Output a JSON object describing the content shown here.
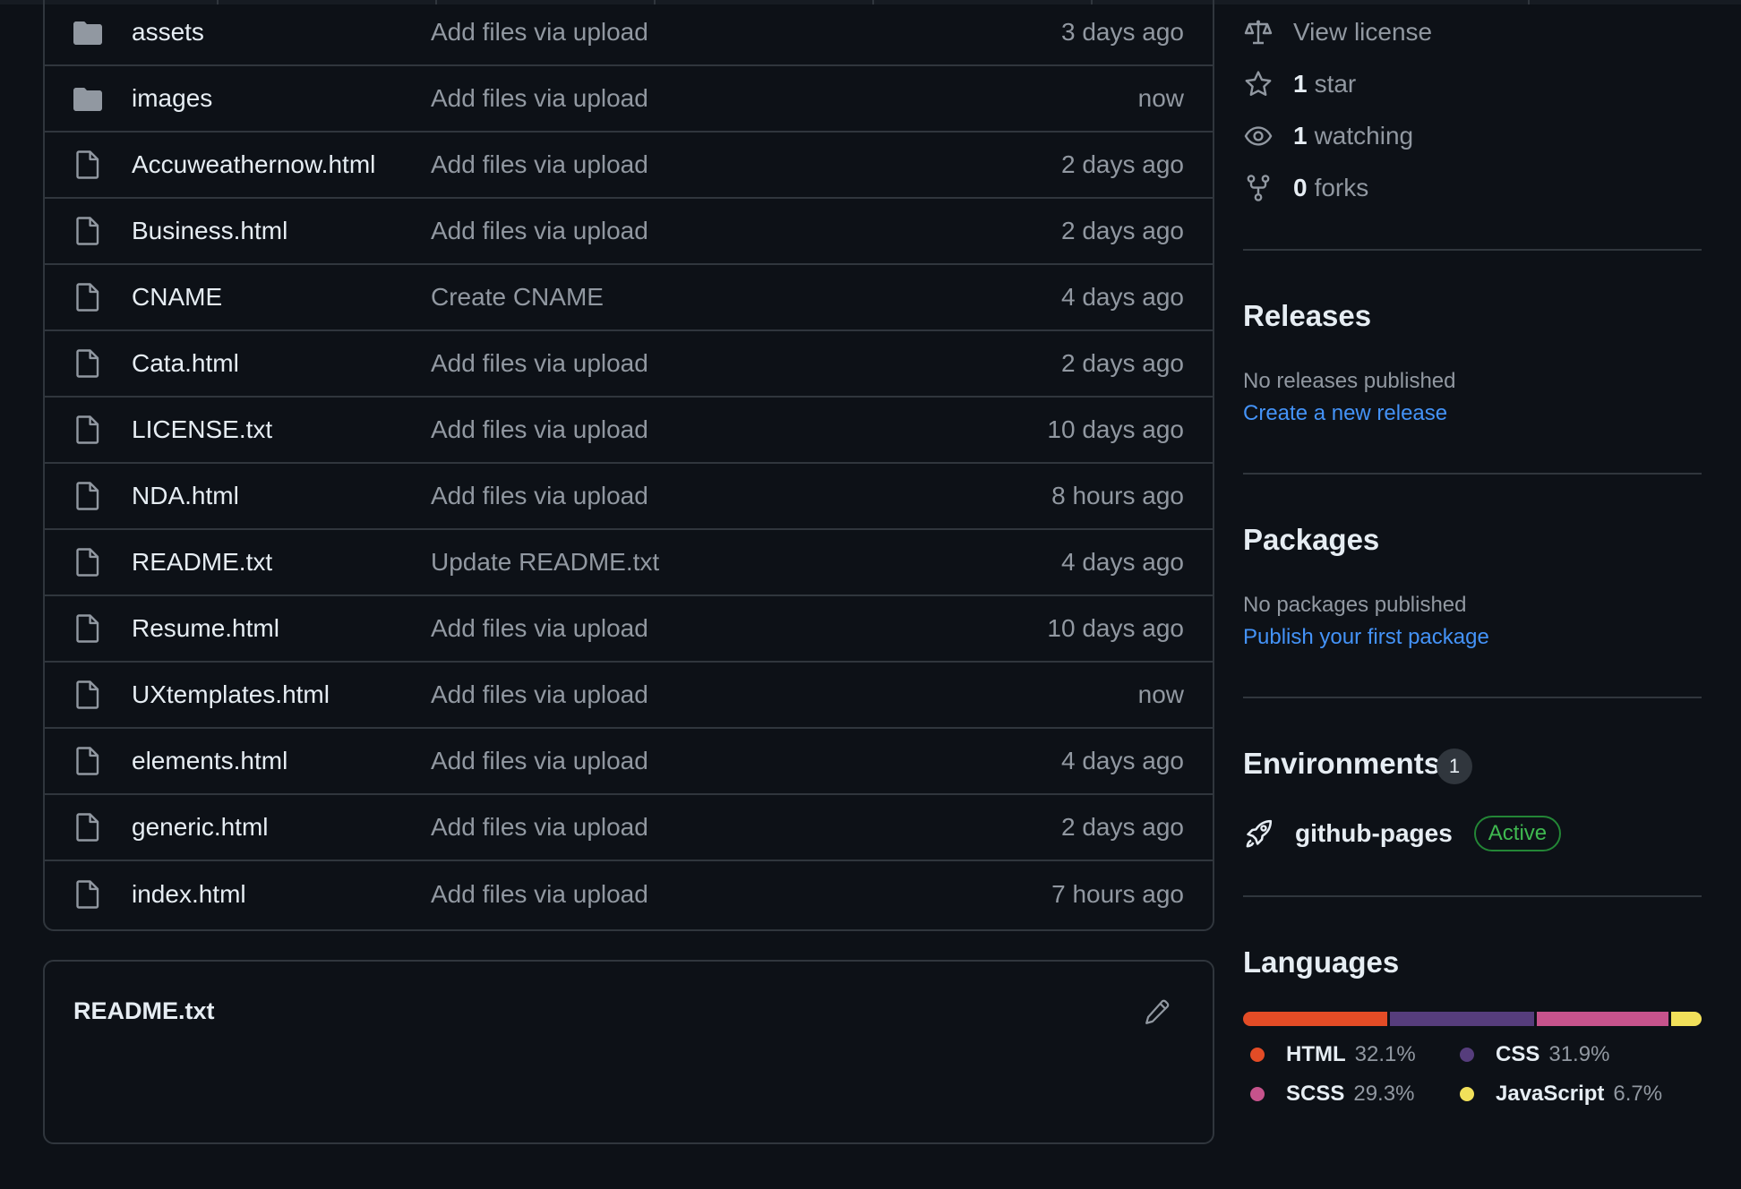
{
  "files": [
    {
      "type": "folder",
      "name": "assets",
      "message": "Add files via upload",
      "age": "3 days ago"
    },
    {
      "type": "folder",
      "name": "images",
      "message": "Add files via upload",
      "age": "now"
    },
    {
      "type": "file",
      "name": "Accuweathernow.html",
      "message": "Add files via upload",
      "age": "2 days ago"
    },
    {
      "type": "file",
      "name": "Business.html",
      "message": "Add files via upload",
      "age": "2 days ago"
    },
    {
      "type": "file",
      "name": "CNAME",
      "message": "Create CNAME",
      "age": "4 days ago"
    },
    {
      "type": "file",
      "name": "Cata.html",
      "message": "Add files via upload",
      "age": "2 days ago"
    },
    {
      "type": "file",
      "name": "LICENSE.txt",
      "message": "Add files via upload",
      "age": "10 days ago"
    },
    {
      "type": "file",
      "name": "NDA.html",
      "message": "Add files via upload",
      "age": "8 hours ago"
    },
    {
      "type": "file",
      "name": "README.txt",
      "message": "Update README.txt",
      "age": "4 days ago"
    },
    {
      "type": "file",
      "name": "Resume.html",
      "message": "Add files via upload",
      "age": "10 days ago"
    },
    {
      "type": "file",
      "name": "UXtemplates.html",
      "message": "Add files via upload",
      "age": "now"
    },
    {
      "type": "file",
      "name": "elements.html",
      "message": "Add files via upload",
      "age": "4 days ago"
    },
    {
      "type": "file",
      "name": "generic.html",
      "message": "Add files via upload",
      "age": "2 days ago"
    },
    {
      "type": "file",
      "name": "index.html",
      "message": "Add files via upload",
      "age": "7 hours ago"
    }
  ],
  "readme": {
    "title": "README.txt",
    "edit_icon": "pencil-icon"
  },
  "about": {
    "license": {
      "icon": "law-icon",
      "label": "View license"
    },
    "stars": {
      "icon": "star-icon",
      "count": "1",
      "label": "star"
    },
    "watching": {
      "icon": "eye-icon",
      "count": "1",
      "label": "watching"
    },
    "forks": {
      "icon": "fork-icon",
      "count": "0",
      "label": "forks"
    }
  },
  "releases": {
    "title": "Releases",
    "empty": "No releases published",
    "link": "Create a new release"
  },
  "packages": {
    "title": "Packages",
    "empty": "No packages published",
    "link": "Publish your first package"
  },
  "environments": {
    "title": "Environments",
    "count": "1",
    "items": [
      {
        "icon": "rocket-icon",
        "name": "github-pages",
        "status": "Active"
      }
    ]
  },
  "languages": {
    "title": "Languages",
    "items": [
      {
        "name": "HTML",
        "percent": "32.1%",
        "value": 32.1,
        "color": "#e34c26"
      },
      {
        "name": "CSS",
        "percent": "31.9%",
        "value": 31.9,
        "color": "#563d7c"
      },
      {
        "name": "SCSS",
        "percent": "29.3%",
        "value": 29.3,
        "color": "#c6538c"
      },
      {
        "name": "JavaScript",
        "percent": "6.7%",
        "value": 6.7,
        "color": "#f1e05a"
      }
    ]
  },
  "colors": {
    "accent_link": "#4493f8",
    "active_green": "#3fb950"
  }
}
